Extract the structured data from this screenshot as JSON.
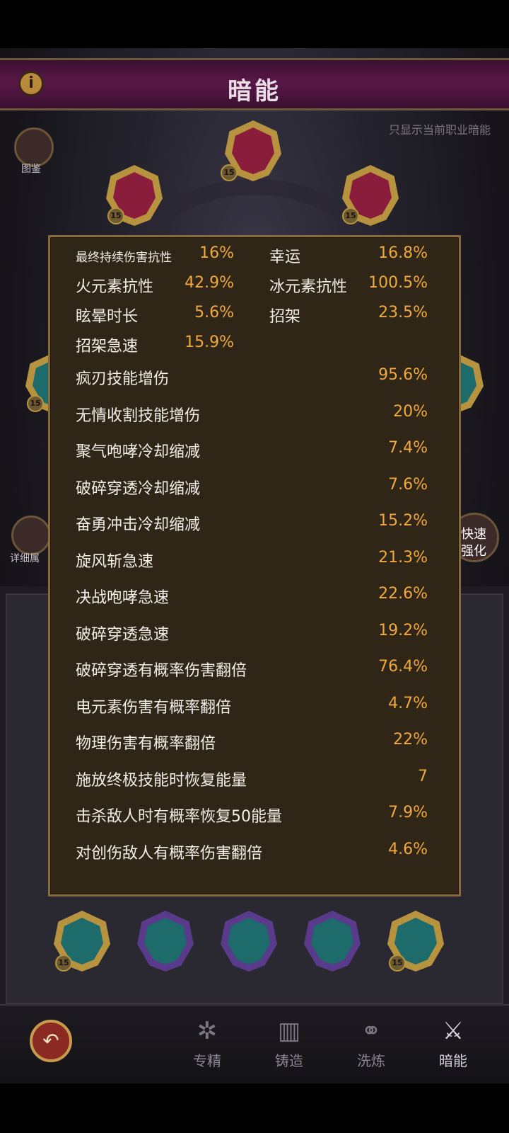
{
  "title": "暗能",
  "info_icon": "i",
  "filter_label": "只显示当前职业暗能",
  "side": {
    "codex_label": "图鉴",
    "detail_label": "详细属",
    "quick_label_1": "快速",
    "quick_label_2": "强化"
  },
  "gems": {
    "level": "15"
  },
  "stats_pairs": [
    {
      "left_name": "最终持续伤害抗性",
      "left_value": "16%",
      "right_name": "幸运",
      "right_value": "16.8%"
    },
    {
      "left_name": "火元素抗性",
      "left_value": "42.9%",
      "right_name": "冰元素抗性",
      "right_value": "100.5%"
    },
    {
      "left_name": "眩晕时长",
      "left_value": "5.6%",
      "right_name": "招架",
      "right_value": "23.5%"
    },
    {
      "left_name": "招架急速",
      "left_value": "15.9%",
      "right_name": "",
      "right_value": ""
    }
  ],
  "stats_list": [
    {
      "name": "疯刃技能增伤",
      "value": "95.6%"
    },
    {
      "name": "无情收割技能增伤",
      "value": "20%"
    },
    {
      "name": "聚气咆哮冷却缩减",
      "value": "7.4%"
    },
    {
      "name": "破碎穿透冷却缩减",
      "value": "7.6%"
    },
    {
      "name": "奋勇冲击冷却缩减",
      "value": "15.2%"
    },
    {
      "name": "旋风斩急速",
      "value": "21.3%"
    },
    {
      "name": "决战咆哮急速",
      "value": "22.6%"
    },
    {
      "name": "破碎穿透急速",
      "value": "19.2%"
    },
    {
      "name": "破碎穿透有概率伤害翻倍",
      "value": "76.4%"
    },
    {
      "name": "电元素伤害有概率翻倍",
      "value": "4.7%"
    },
    {
      "name": "物理伤害有概率翻倍",
      "value": "22%"
    },
    {
      "name": "施放终极技能时恢复能量",
      "value": "7"
    },
    {
      "name": "击杀敌人时有概率恢复50能量",
      "value": "7.9%"
    },
    {
      "name": "对创伤敌人有概率伤害翻倍",
      "value": "4.6%"
    }
  ],
  "nav": [
    {
      "label": "专精",
      "icon": "tree-icon"
    },
    {
      "label": "铸造",
      "icon": "anvil-icon"
    },
    {
      "label": "洗炼",
      "icon": "circles-icon"
    },
    {
      "label": "暗能",
      "icon": "dark-energy-icon"
    }
  ],
  "colors": {
    "value": "#f1a83d",
    "title_bar": "#5a1748",
    "popup_bg": "#2f2618",
    "popup_border": "#8a6a3a"
  }
}
